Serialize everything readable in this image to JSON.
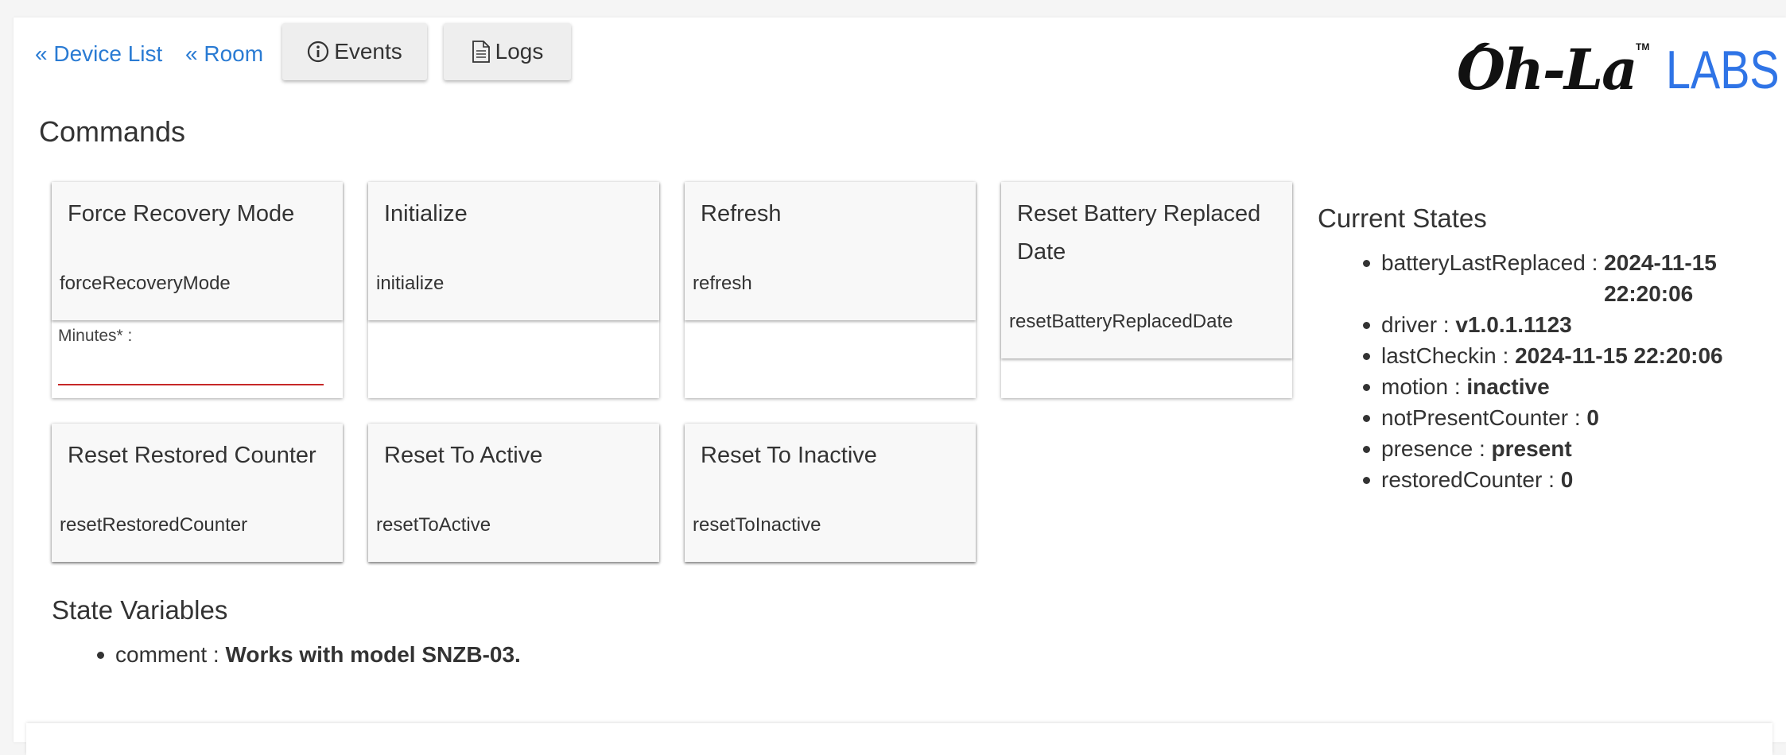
{
  "nav": {
    "device_list": "« Device List",
    "room": "« Room",
    "events": "Events",
    "logs": "Logs"
  },
  "logo": {
    "script": "Oh-La",
    "tm": "TM",
    "labs": "LABS"
  },
  "commands": {
    "title": "Commands",
    "items": [
      {
        "label": "Force Recovery Mode",
        "code": "forceRecoveryMode",
        "param_label": "Minutes* :",
        "param_value": ""
      },
      {
        "label": "Initialize",
        "code": "initialize"
      },
      {
        "label": "Refresh",
        "code": "refresh"
      },
      {
        "label": "Reset Battery Replaced Date",
        "code": "resetBatteryReplacedDate"
      },
      {
        "label": "Reset Restored Counter",
        "code": "resetRestoredCounter"
      },
      {
        "label": "Reset To Active",
        "code": "resetToActive"
      },
      {
        "label": "Reset To Inactive",
        "code": "resetToInactive"
      }
    ]
  },
  "current_states": {
    "title": "Current States",
    "items": [
      {
        "key": "batteryLastReplaced",
        "sep": " : ",
        "value": "2024-11-15 22:20:06"
      },
      {
        "key": "driver",
        "sep": " : ",
        "value": "v1.0.1.1123"
      },
      {
        "key": "lastCheckin",
        "sep": " : ",
        "value": "2024-11-15 22:20:06"
      },
      {
        "key": "motion",
        "sep": " : ",
        "value": "inactive"
      },
      {
        "key": "notPresentCounter",
        "sep": " : ",
        "value": "0"
      },
      {
        "key": "presence",
        "sep": " : ",
        "value": "present"
      },
      {
        "key": "restoredCounter",
        "sep": " : ",
        "value": "0"
      }
    ]
  },
  "state_variables": {
    "title": "State Variables",
    "items": [
      {
        "key": "comment",
        "sep": " : ",
        "value": "Works with model SNZB-03."
      }
    ]
  },
  "colors": {
    "link": "#2a7bd3",
    "labs_blue": "#2f74e6",
    "required_underline": "#c62828"
  }
}
